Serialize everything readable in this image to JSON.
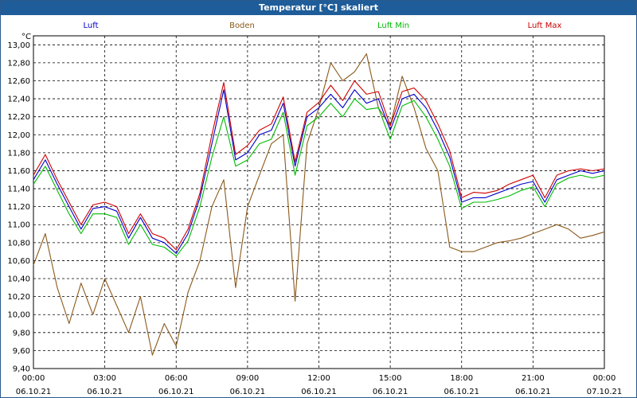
{
  "window": {
    "title": "Temperatur [°C] skaliert"
  },
  "chart_data": {
    "type": "line",
    "title": "Temperatur [°C] skaliert",
    "ylabel": "°C",
    "ylim": [
      9.4,
      13.1
    ],
    "xlim": [
      0,
      24
    ],
    "yticks": [
      "13,00",
      "12,80",
      "12,60",
      "12,40",
      "12,20",
      "12,00",
      "11,80",
      "11,60",
      "11,40",
      "11,20",
      "11,00",
      "10,80",
      "10,60",
      "10,40",
      "10,20",
      "10,00",
      "9,80",
      "9,60",
      "9,40"
    ],
    "xticks": [
      {
        "time": "00:00",
        "date": "06.10.21"
      },
      {
        "time": "03:00",
        "date": "06.10.21"
      },
      {
        "time": "06:00",
        "date": "06.10.21"
      },
      {
        "time": "09:00",
        "date": "06.10.21"
      },
      {
        "time": "12:00",
        "date": "06.10.21"
      },
      {
        "time": "15:00",
        "date": "06.10.21"
      },
      {
        "time": "18:00",
        "date": "06.10.21"
      },
      {
        "time": "21:00",
        "date": "06.10.21"
      },
      {
        "time": "00:00",
        "date": "07.10.21"
      }
    ],
    "grid": true,
    "legend_position": "top",
    "series": [
      {
        "name": "Luft",
        "color": "#0000cc",
        "points": [
          [
            0,
            11.5
          ],
          [
            0.5,
            11.72
          ],
          [
            1,
            11.45
          ],
          [
            1.5,
            11.2
          ],
          [
            2,
            10.95
          ],
          [
            2.5,
            11.18
          ],
          [
            3,
            11.2
          ],
          [
            3.5,
            11.15
          ],
          [
            4,
            10.85
          ],
          [
            4.5,
            11.08
          ],
          [
            5,
            10.85
          ],
          [
            5.5,
            10.8
          ],
          [
            6,
            10.68
          ],
          [
            6.5,
            10.9
          ],
          [
            7,
            11.3
          ],
          [
            7.5,
            11.9
          ],
          [
            8,
            12.5
          ],
          [
            8.5,
            11.72
          ],
          [
            9,
            11.8
          ],
          [
            9.5,
            12.0
          ],
          [
            10,
            12.05
          ],
          [
            10.5,
            12.35
          ],
          [
            11,
            11.65
          ],
          [
            11.5,
            12.2
          ],
          [
            12,
            12.3
          ],
          [
            12.5,
            12.45
          ],
          [
            13,
            12.3
          ],
          [
            13.5,
            12.5
          ],
          [
            14,
            12.35
          ],
          [
            14.5,
            12.4
          ],
          [
            15,
            12.05
          ],
          [
            15.5,
            12.4
          ],
          [
            16,
            12.45
          ],
          [
            16.5,
            12.3
          ],
          [
            17,
            12.05
          ],
          [
            17.5,
            11.75
          ],
          [
            18,
            11.25
          ],
          [
            18.5,
            11.3
          ],
          [
            19,
            11.3
          ],
          [
            19.5,
            11.35
          ],
          [
            20,
            11.4
          ],
          [
            20.5,
            11.45
          ],
          [
            21,
            11.48
          ],
          [
            21.5,
            11.25
          ],
          [
            22,
            11.5
          ],
          [
            22.5,
            11.55
          ],
          [
            23,
            11.6
          ],
          [
            23.5,
            11.57
          ],
          [
            24,
            11.6
          ]
        ]
      },
      {
        "name": "Boden",
        "color": "#8b5a1b",
        "points": [
          [
            0,
            10.55
          ],
          [
            0.5,
            10.9
          ],
          [
            1,
            10.3
          ],
          [
            1.5,
            9.9
          ],
          [
            2,
            10.35
          ],
          [
            2.5,
            10.0
          ],
          [
            3,
            10.4
          ],
          [
            3.5,
            10.1
          ],
          [
            4,
            9.8
          ],
          [
            4.5,
            10.2
          ],
          [
            5,
            9.55
          ],
          [
            5.5,
            9.9
          ],
          [
            6,
            9.65
          ],
          [
            6.5,
            10.25
          ],
          [
            7,
            10.6
          ],
          [
            7.5,
            11.2
          ],
          [
            8,
            11.5
          ],
          [
            8.5,
            10.3
          ],
          [
            9,
            11.2
          ],
          [
            9.5,
            11.55
          ],
          [
            10,
            11.9
          ],
          [
            10.5,
            12.0
          ],
          [
            11,
            10.15
          ],
          [
            11.5,
            11.9
          ],
          [
            12,
            12.3
          ],
          [
            12.5,
            12.8
          ],
          [
            13,
            12.6
          ],
          [
            13.5,
            12.7
          ],
          [
            14,
            12.9
          ],
          [
            14.5,
            12.3
          ],
          [
            15,
            12.1
          ],
          [
            15.5,
            12.65
          ],
          [
            16,
            12.3
          ],
          [
            16.5,
            11.85
          ],
          [
            17,
            11.6
          ],
          [
            17.5,
            10.75
          ],
          [
            18,
            10.7
          ],
          [
            18.5,
            10.7
          ],
          [
            19,
            10.75
          ],
          [
            19.5,
            10.8
          ],
          [
            20,
            10.82
          ],
          [
            20.5,
            10.85
          ],
          [
            21,
            10.9
          ],
          [
            21.5,
            10.95
          ],
          [
            22,
            11.0
          ],
          [
            22.5,
            10.95
          ],
          [
            23,
            10.85
          ],
          [
            23.5,
            10.88
          ],
          [
            24,
            10.92
          ]
        ]
      },
      {
        "name": "Luft Min",
        "color": "#00bb00",
        "points": [
          [
            0,
            11.45
          ],
          [
            0.5,
            11.65
          ],
          [
            1,
            11.38
          ],
          [
            1.5,
            11.12
          ],
          [
            2,
            10.9
          ],
          [
            2.5,
            11.12
          ],
          [
            3,
            11.12
          ],
          [
            3.5,
            11.08
          ],
          [
            4,
            10.78
          ],
          [
            4.5,
            11.0
          ],
          [
            5,
            10.78
          ],
          [
            5.5,
            10.75
          ],
          [
            6,
            10.65
          ],
          [
            6.5,
            10.82
          ],
          [
            7,
            11.2
          ],
          [
            7.5,
            11.75
          ],
          [
            8,
            12.2
          ],
          [
            8.5,
            11.65
          ],
          [
            9,
            11.72
          ],
          [
            9.5,
            11.9
          ],
          [
            10,
            11.95
          ],
          [
            10.5,
            12.25
          ],
          [
            11,
            11.55
          ],
          [
            11.5,
            12.1
          ],
          [
            12,
            12.2
          ],
          [
            12.5,
            12.35
          ],
          [
            13,
            12.2
          ],
          [
            13.5,
            12.4
          ],
          [
            14,
            12.28
          ],
          [
            14.5,
            12.3
          ],
          [
            15,
            11.95
          ],
          [
            15.5,
            12.32
          ],
          [
            16,
            12.38
          ],
          [
            16.5,
            12.2
          ],
          [
            17,
            11.95
          ],
          [
            17.5,
            11.65
          ],
          [
            18,
            11.18
          ],
          [
            18.5,
            11.25
          ],
          [
            19,
            11.25
          ],
          [
            19.5,
            11.28
          ],
          [
            20,
            11.32
          ],
          [
            20.5,
            11.38
          ],
          [
            21,
            11.42
          ],
          [
            21.5,
            11.2
          ],
          [
            22,
            11.45
          ],
          [
            22.5,
            11.52
          ],
          [
            23,
            11.55
          ],
          [
            23.5,
            11.52
          ],
          [
            24,
            11.55
          ]
        ]
      },
      {
        "name": "Luft Max",
        "color": "#cc0000",
        "points": [
          [
            0,
            11.55
          ],
          [
            0.5,
            11.78
          ],
          [
            1,
            11.5
          ],
          [
            1.5,
            11.25
          ],
          [
            2,
            11.0
          ],
          [
            2.5,
            11.22
          ],
          [
            3,
            11.25
          ],
          [
            3.5,
            11.2
          ],
          [
            4,
            10.9
          ],
          [
            4.5,
            11.12
          ],
          [
            5,
            10.9
          ],
          [
            5.5,
            10.85
          ],
          [
            6,
            10.72
          ],
          [
            6.5,
            10.95
          ],
          [
            7,
            11.35
          ],
          [
            7.5,
            12.0
          ],
          [
            8,
            12.58
          ],
          [
            8.5,
            11.78
          ],
          [
            9,
            11.88
          ],
          [
            9.5,
            12.05
          ],
          [
            10,
            12.12
          ],
          [
            10.5,
            12.42
          ],
          [
            11,
            11.7
          ],
          [
            11.5,
            12.25
          ],
          [
            12,
            12.36
          ],
          [
            12.5,
            12.55
          ],
          [
            13,
            12.38
          ],
          [
            13.5,
            12.6
          ],
          [
            14,
            12.45
          ],
          [
            14.5,
            12.48
          ],
          [
            15,
            12.1
          ],
          [
            15.5,
            12.48
          ],
          [
            16,
            12.52
          ],
          [
            16.5,
            12.38
          ],
          [
            17,
            12.12
          ],
          [
            17.5,
            11.82
          ],
          [
            18,
            11.3
          ],
          [
            18.5,
            11.36
          ],
          [
            19,
            11.35
          ],
          [
            19.5,
            11.38
          ],
          [
            20,
            11.45
          ],
          [
            20.5,
            11.5
          ],
          [
            21,
            11.55
          ],
          [
            21.5,
            11.3
          ],
          [
            22,
            11.55
          ],
          [
            22.5,
            11.6
          ],
          [
            23,
            11.62
          ],
          [
            23.5,
            11.6
          ],
          [
            24,
            11.62
          ]
        ]
      }
    ]
  }
}
